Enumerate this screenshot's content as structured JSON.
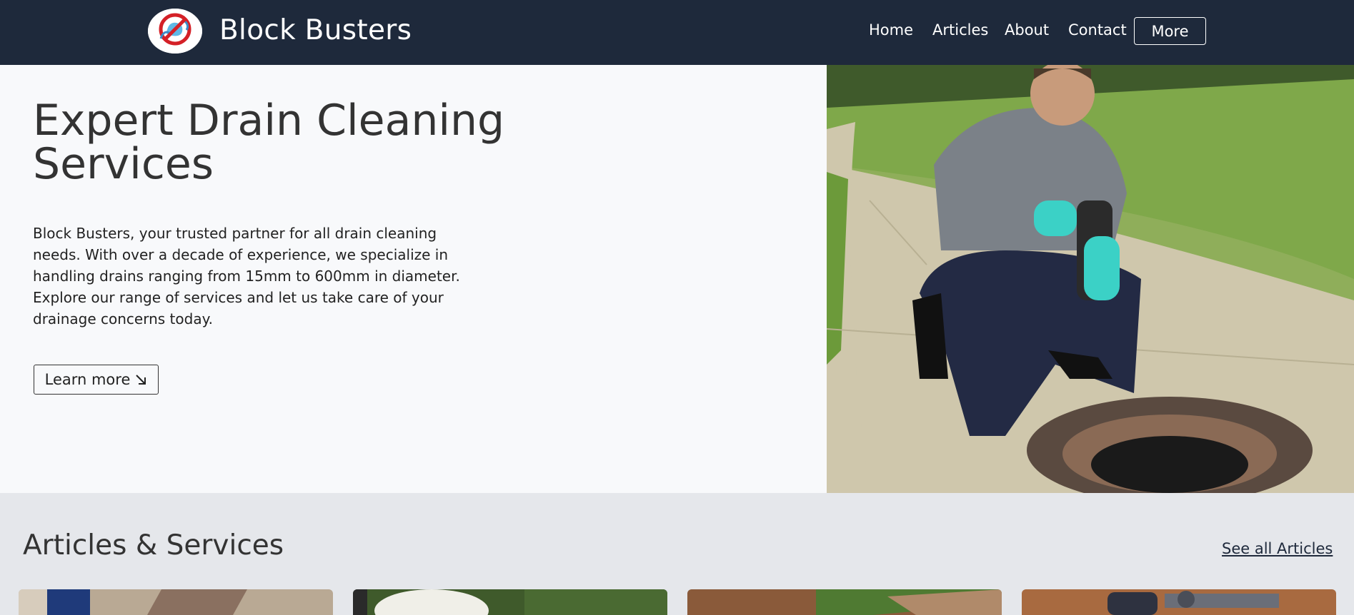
{
  "header": {
    "brand": "Block Busters",
    "nav": {
      "home": "Home",
      "articles": "Articles",
      "about": "About",
      "contact": "Contact",
      "more": "More"
    }
  },
  "hero": {
    "title": "Expert Drain Cleaning Services",
    "description": "Block Busters, your trusted partner for all drain cleaning needs. With over a decade of experience, we specialize in handling drains ranging from 15mm to 600mm in diameter. Explore our range of services and let us take care of your drainage concerns today.",
    "learn_more": "Learn more",
    "learn_more_icon": "arrow-down-right-icon"
  },
  "articles": {
    "title": "Articles & Services",
    "see_all": "See all Articles"
  },
  "colors": {
    "header_bg": "#1e293b",
    "hero_bg": "#f8f9fb",
    "section_bg": "#e5e7eb"
  }
}
